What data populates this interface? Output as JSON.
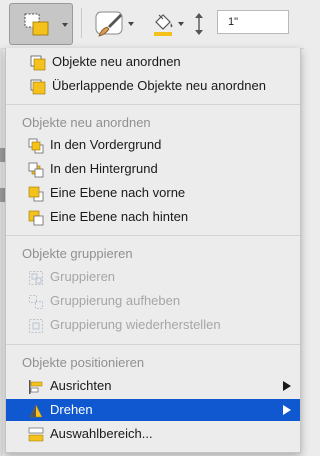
{
  "toolbar": {
    "height_value": "1\"",
    "colors": {
      "selected_button_bg": "#c6c6c6",
      "shape_yellow": "#f4c11d"
    }
  },
  "menu": {
    "items_top": [
      {
        "label": "Objekte neu anordnen",
        "icon": "reorder-objects-icon"
      },
      {
        "label": "Überlappende Objekte neu anordnen",
        "icon": "reorder-overlapping-icon"
      }
    ],
    "sections": {
      "arrange": {
        "heading": "Objekte neu anordnen",
        "items": [
          {
            "label": "In den Vordergrund",
            "icon": "bring-to-front-icon"
          },
          {
            "label": "In den Hintergrund",
            "icon": "send-to-back-icon"
          },
          {
            "label": "Eine Ebene nach vorne",
            "icon": "bring-forward-icon"
          },
          {
            "label": "Eine Ebene nach hinten",
            "icon": "send-backward-icon"
          }
        ]
      },
      "group": {
        "heading": "Objekte gruppieren",
        "items": [
          {
            "label": "Gruppieren",
            "icon": "group-icon",
            "disabled": true
          },
          {
            "label": "Gruppierung aufheben",
            "icon": "ungroup-icon",
            "disabled": true
          },
          {
            "label": "Gruppierung wiederherstellen",
            "icon": "regroup-icon",
            "disabled": true
          }
        ]
      },
      "position": {
        "heading": "Objekte positionieren",
        "items": [
          {
            "label": "Ausrichten",
            "icon": "align-icon",
            "submenu": true
          },
          {
            "label": "Drehen",
            "icon": "rotate-icon",
            "submenu": true,
            "selected": true
          },
          {
            "label": "Auswahlbereich...",
            "icon": "selection-pane-icon"
          }
        ]
      }
    },
    "colors": {
      "highlight": "#0f58cf",
      "disabled_text": "#a6a6a6",
      "heading_text": "#909090"
    }
  }
}
